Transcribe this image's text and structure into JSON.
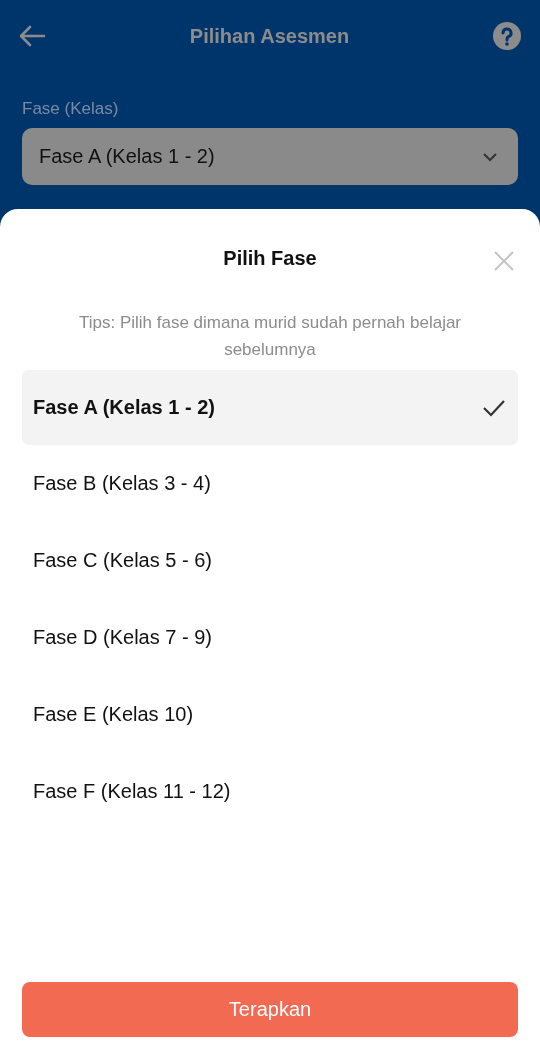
{
  "header": {
    "title": "Pilihan Asesmen"
  },
  "field": {
    "label": "Fase (Kelas)",
    "value": "Fase A (Kelas 1 - 2)"
  },
  "sheet": {
    "title": "Pilih Fase",
    "tips": "Tips: Pilih fase dimana murid sudah pernah belajar sebelumnya",
    "options": [
      {
        "label": "Fase A (Kelas 1 - 2)",
        "selected": true
      },
      {
        "label": "Fase B (Kelas 3 - 4)",
        "selected": false
      },
      {
        "label": "Fase C (Kelas 5 - 6)",
        "selected": false
      },
      {
        "label": "Fase D (Kelas 7 - 9)",
        "selected": false
      },
      {
        "label": "Fase E (Kelas 10)",
        "selected": false
      },
      {
        "label": "Fase F (Kelas 11 - 12)",
        "selected": false
      }
    ],
    "button": "Terapkan"
  }
}
